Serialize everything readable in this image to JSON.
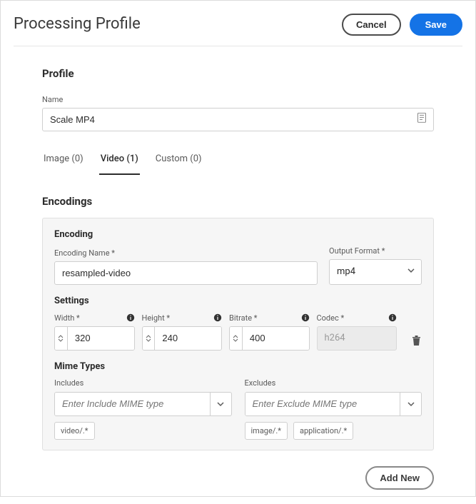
{
  "header": {
    "title": "Processing Profile",
    "cancel_label": "Cancel",
    "save_label": "Save"
  },
  "profile": {
    "section_title": "Profile",
    "name_label": "Name",
    "name_value": "Scale MP4"
  },
  "tabs": [
    {
      "label": "Image (0)",
      "active": false
    },
    {
      "label": "Video (1)",
      "active": true
    },
    {
      "label": "Custom (0)",
      "active": false
    }
  ],
  "encodings": {
    "section_title": "Encodings",
    "card": {
      "encoding_title": "Encoding",
      "encoding_name_label": "Encoding Name *",
      "encoding_name_value": "resampled-video",
      "output_format_label": "Output Format *",
      "output_format_value": "mp4",
      "settings_title": "Settings",
      "settings": {
        "width": {
          "label": "Width *",
          "value": "320"
        },
        "height": {
          "label": "Height *",
          "value": "240"
        },
        "bitrate": {
          "label": "Bitrate *",
          "value": "400"
        },
        "codec": {
          "label": "Codec *",
          "value": "h264"
        }
      },
      "mime_title": "Mime Types",
      "mime": {
        "includes_label": "Includes",
        "includes_placeholder": "Enter Include MIME type",
        "includes_chips": [
          "video/.*"
        ],
        "excludes_label": "Excludes",
        "excludes_placeholder": "Enter Exclude MIME type",
        "excludes_chips": [
          "image/.*",
          "application/.*"
        ]
      }
    },
    "add_new_label": "Add New"
  }
}
